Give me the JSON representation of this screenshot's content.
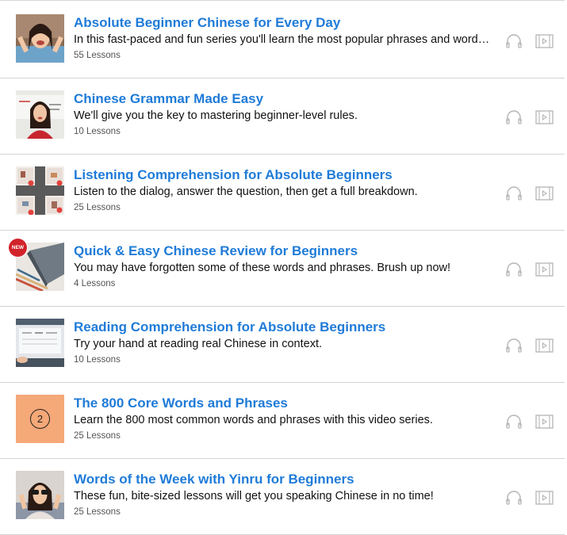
{
  "series": [
    {
      "title": "Absolute Beginner Chinese for Every Day",
      "description": "In this fast-paced and fun series you'll learn the most popular phrases and words…",
      "lessons": "55 Lessons",
      "thumbnail": "woman-smiling-photo",
      "badge": ""
    },
    {
      "title": "Chinese Grammar Made Easy",
      "description": "We'll give you the key to mastering beginner-level rules.",
      "lessons": "10 Lessons",
      "thumbnail": "woman-whiteboard-photo",
      "badge": ""
    },
    {
      "title": "Listening Comprehension for Absolute Beginners",
      "description": "Listen to the dialog, answer the question, then get a full breakdown.",
      "lessons": "25 Lessons",
      "thumbnail": "numbered-rooms-illustration",
      "badge": ""
    },
    {
      "title": "Quick & Easy Chinese Review for Beginners",
      "description": "You may have forgotten some of these words and phrases. Brush up now!",
      "lessons": "4 Lessons",
      "thumbnail": "pencils-notebook-photo",
      "badge": "NEW"
    },
    {
      "title": "Reading Comprehension for Absolute Beginners",
      "description": "Try your hand at reading real Chinese in context.",
      "lessons": "10 Lessons",
      "thumbnail": "train-ticket-screen-photo",
      "badge": ""
    },
    {
      "title": "The 800 Core Words and Phrases",
      "description": "Learn the 800 most common words and phrases with this video series.",
      "lessons": "25 Lessons",
      "thumbnail": "numbered-orange-tile",
      "badge": "2"
    },
    {
      "title": "Words of the Week with Yinru for Beginners",
      "description": "These fun, bite-sized lessons will get you speaking Chinese in no time!",
      "lessons": "25 Lessons",
      "thumbnail": "woman-sunglasses-photo",
      "badge": ""
    }
  ],
  "icons": {
    "audio": "headphones-icon",
    "video": "video-file-icon"
  },
  "colors": {
    "title": "#1f7bd8",
    "text": "#111111",
    "muted": "#555555",
    "divider": "#d4d4d4",
    "icon": "#b5b5b5",
    "new_badge": "#d2232a",
    "orange_tile": "#f5a878"
  }
}
